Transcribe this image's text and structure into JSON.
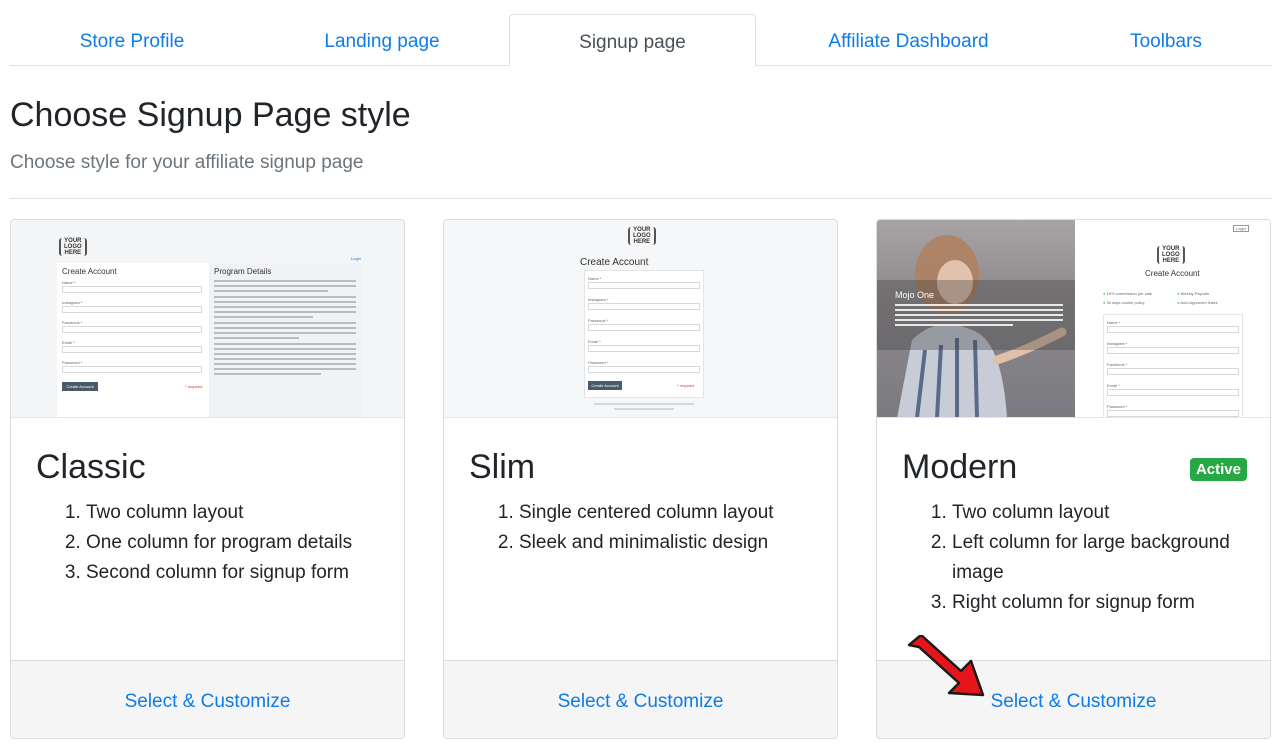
{
  "tabs": [
    {
      "label": "Store Profile"
    },
    {
      "label": "Landing page"
    },
    {
      "label": "Signup page"
    },
    {
      "label": "Affiliate Dashboard"
    },
    {
      "label": "Toolbars"
    }
  ],
  "active_tab": "Signup page",
  "heading": "Choose Signup Page style",
  "subheading": "Choose style for your affiliate signup page",
  "cards": [
    {
      "title": "Classic",
      "features": [
        "Two column layout",
        "One column for program details",
        "Second column for signup form"
      ],
      "action": "Select & Customize",
      "preview": {
        "logo": "YOUR\nLOGO\nHERE",
        "login": "Login",
        "form_title": "Create Account",
        "details_title": "Program Details",
        "button": "Create Account",
        "required": "* required",
        "fields": [
          "Name *",
          "Instagram *",
          "Facebook *",
          "Email *",
          "Password *"
        ]
      }
    },
    {
      "title": "Slim",
      "features": [
        "Single centered column layout",
        "Sleek and minimalistic design"
      ],
      "action": "Select & Customize",
      "preview": {
        "logo": "YOUR\nLOGO\nHERE",
        "form_title": "Create Account",
        "button": "Create Account",
        "required": "* required",
        "fields": [
          "Name *",
          "Instagram *",
          "Facebook *",
          "Email *",
          "Password *"
        ]
      }
    },
    {
      "title": "Modern",
      "badge": "Active",
      "features": [
        "Two column layout",
        "Left column for large background image",
        "Right column for signup form"
      ],
      "action": "Select & Customize",
      "preview": {
        "logo": "YOUR\nLOGO\nHERE",
        "login": "Login",
        "brand": "Mojo One",
        "form_title": "Create Account",
        "perks": [
          "15% commission per sale",
          "Weekly Payouts",
          "30 days cookie policy",
          "Auto Approved Sales"
        ],
        "fields": [
          "Name *",
          "Instagram *",
          "Facebook *",
          "Email *",
          "Password *"
        ]
      }
    }
  ],
  "colors": {
    "link": "#0d7ce8",
    "active_badge": "#28a745",
    "arrow": "#e8141c"
  }
}
